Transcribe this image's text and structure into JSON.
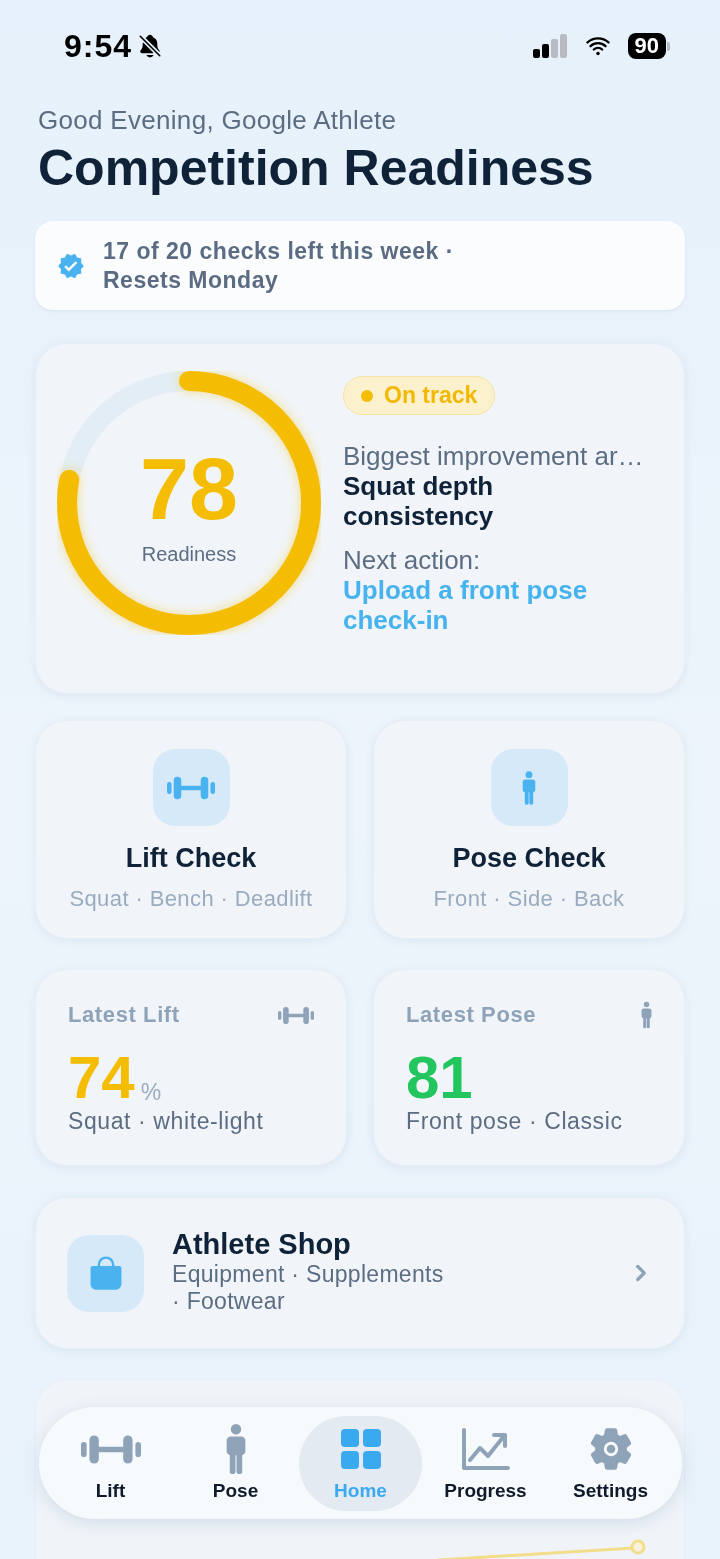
{
  "status_bar": {
    "time": "9:54",
    "battery": "90"
  },
  "header": {
    "greeting": "Good Evening, Google Athlete",
    "title": "Competition Readiness"
  },
  "checks_banner": {
    "text": "17 of 20 checks left this week · Resets Monday"
  },
  "readiness": {
    "score": "78",
    "label": "Readiness",
    "level": 0.78,
    "status": "On track",
    "improvement_label": "Biggest improvement ar…",
    "improvement": "Squat depth consistency",
    "next_action_label": "Next action:",
    "next_action": "Upload a front pose check-in"
  },
  "check_cards": [
    {
      "title": "Lift Check",
      "subtitle": "Squat · Bench · Deadlift"
    },
    {
      "title": "Pose Check",
      "subtitle": "Front · Side · Back"
    }
  ],
  "latest": [
    {
      "label": "Latest Lift",
      "value": "74",
      "unit": "%",
      "detail": "Squat · white-light",
      "color": "#f5bd02"
    },
    {
      "label": "Latest Pose",
      "value": "81",
      "detail": "Front pose · Classic",
      "color": "#22c55e"
    }
  ],
  "shop": {
    "title": "Athlete Shop",
    "subtitle": "Equipment · Supplements · Footwear"
  },
  "tab_bar": [
    {
      "label": "Lift",
      "selected": false
    },
    {
      "label": "Pose",
      "selected": false
    },
    {
      "label": "Home",
      "selected": true
    },
    {
      "label": "Progress",
      "selected": false
    },
    {
      "label": "Settings",
      "selected": false
    }
  ]
}
